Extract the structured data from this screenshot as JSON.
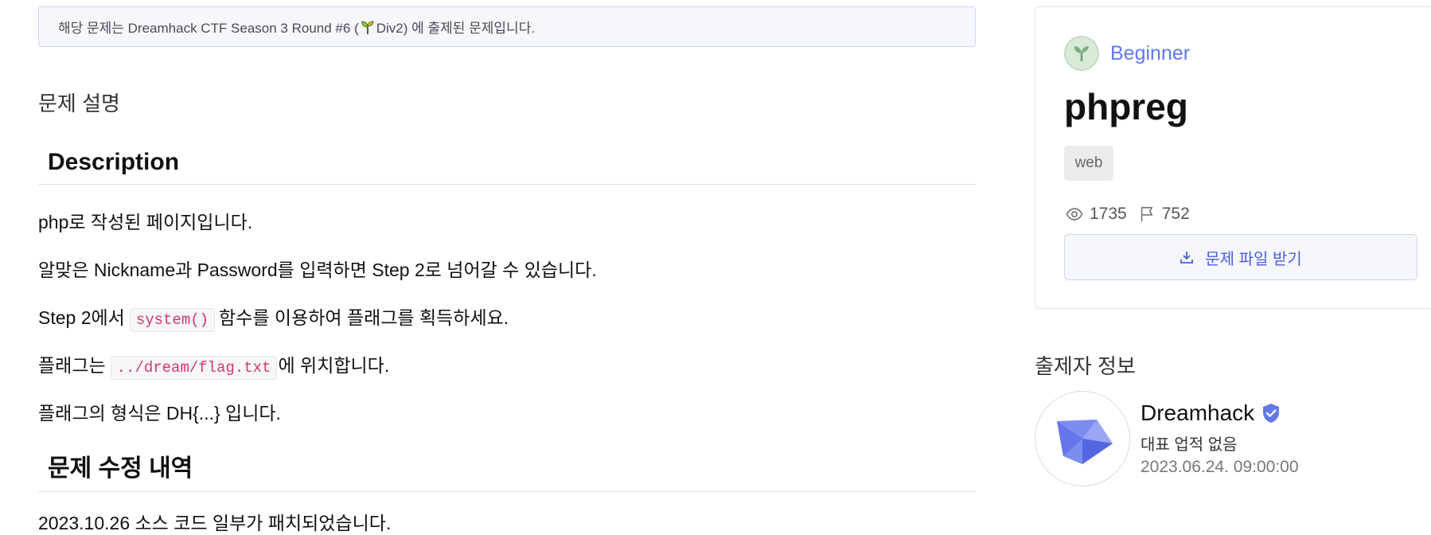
{
  "notice": {
    "prefix": "해당 문제는 Dreamhack CTF Season 3 Round #6 (",
    "suffix": "Div2) 에 출제된 문제입니다."
  },
  "section_title": "문제 설명",
  "description": {
    "heading": "Description",
    "p1": "php로 작성된 페이지입니다.",
    "p2": "알맞은 Nickname과 Password를 입력하면 Step 2로 넘어갈 수 있습니다.",
    "p3_pre": "Step 2에서",
    "p3_code": "system()",
    "p3_post": "함수를 이용하여 플래그를 획득하세요.",
    "p4_pre": "플래그는",
    "p4_code": "../dream/flag.txt",
    "p4_post": "에 위치합니다.",
    "p5": "플래그의 형식은 DH{...} 입니다."
  },
  "revision": {
    "heading": "문제 수정 내역",
    "partial": "2023.10.26 소스 코드 일부가 패치되었습니다."
  },
  "card": {
    "level": "Beginner",
    "title": "phpreg",
    "tag": "web",
    "views": "1735",
    "solves": "752",
    "download_label": "문제 파일 받기"
  },
  "author": {
    "section_title": "출제자 정보",
    "name": "Dreamhack",
    "subtitle": "대표 업적 없음",
    "date": "2023.06.24. 09:00:00"
  },
  "colors": {
    "accent": "#6278e8",
    "code": "#d63865",
    "notice_bg": "#f5f7fd"
  }
}
